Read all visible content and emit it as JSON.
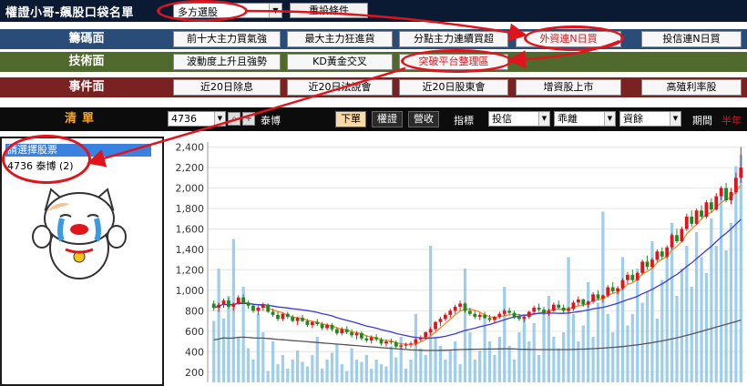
{
  "app": {
    "title": "權證小哥-飆股口袋名單"
  },
  "filter": {
    "selected": "多方選股",
    "reset_label": "重設條件"
  },
  "rows": {
    "chip": {
      "label": "籌碼面",
      "buttons": [
        "前十大主力買氣強",
        "最大主力狂進貨",
        "分點主力連續買超",
        "外資連N日買",
        "投信連N日買"
      ]
    },
    "tech": {
      "label": "技術面",
      "buttons": [
        "波動度上升且強勢",
        "KD黃金交叉",
        "突破平台整理區"
      ]
    },
    "event": {
      "label": "事件面",
      "buttons": [
        "近20日除息",
        "近20日法說會",
        "近20日股東會",
        "增資股上市",
        "高殖利率股"
      ]
    }
  },
  "list": {
    "title": "清單",
    "header": "請選擇股票",
    "items": [
      {
        "code": "4736",
        "name": "泰博",
        "count": "(2)"
      }
    ]
  },
  "toolbar": {
    "stock_code": "4736",
    "stock_name": "泰博",
    "buttons": [
      "下單",
      "權證",
      "營收"
    ],
    "indicator_label": "指標",
    "selects": [
      "投信",
      "乖離",
      "資餘"
    ],
    "period_label": "期間",
    "period_value": "半年"
  },
  "chart_data": {
    "type": "candlestick",
    "y_ticks": [
      200,
      400,
      600,
      800,
      1000,
      1200,
      1400,
      1600,
      1800,
      2000,
      2200,
      2400
    ],
    "y_tick_labels": [
      "200",
      "400",
      "600",
      "800",
      "1,000",
      "1,200",
      "1,400",
      "1,600",
      "1,800",
      "2,000",
      "2,200",
      "2,400"
    ],
    "ylim": [
      100,
      2450
    ],
    "grid": true,
    "ohlc": [
      [
        870,
        900,
        800,
        830
      ],
      [
        830,
        880,
        790,
        860
      ],
      [
        860,
        920,
        830,
        900
      ],
      [
        900,
        930,
        820,
        840
      ],
      [
        840,
        880,
        800,
        870
      ],
      [
        870,
        950,
        860,
        930
      ],
      [
        930,
        960,
        870,
        880
      ],
      [
        880,
        900,
        820,
        850
      ],
      [
        850,
        870,
        780,
        800
      ],
      [
        800,
        850,
        760,
        830
      ],
      [
        830,
        880,
        800,
        860
      ],
      [
        860,
        870,
        780,
        790
      ],
      [
        790,
        820,
        740,
        760
      ],
      [
        760,
        790,
        700,
        720
      ],
      [
        720,
        780,
        700,
        770
      ],
      [
        770,
        790,
        720,
        740
      ],
      [
        740,
        760,
        690,
        700
      ],
      [
        700,
        740,
        660,
        730
      ],
      [
        730,
        760,
        690,
        700
      ],
      [
        700,
        720,
        640,
        660
      ],
      [
        660,
        700,
        630,
        690
      ],
      [
        690,
        720,
        650,
        670
      ],
      [
        670,
        690,
        610,
        630
      ],
      [
        630,
        680,
        610,
        660
      ],
      [
        660,
        680,
        600,
        620
      ],
      [
        620,
        640,
        560,
        580
      ],
      [
        580,
        640,
        560,
        620
      ],
      [
        620,
        650,
        570,
        590
      ],
      [
        590,
        620,
        540,
        560
      ],
      [
        560,
        600,
        520,
        580
      ],
      [
        580,
        600,
        510,
        530
      ],
      [
        530,
        560,
        490,
        510
      ],
      [
        510,
        560,
        480,
        540
      ],
      [
        540,
        570,
        500,
        520
      ],
      [
        520,
        540,
        460,
        480
      ],
      [
        480,
        520,
        450,
        500
      ],
      [
        500,
        530,
        470,
        490
      ],
      [
        490,
        510,
        430,
        450
      ],
      [
        450,
        480,
        420,
        460
      ],
      [
        460,
        490,
        430,
        470
      ],
      [
        470,
        500,
        440,
        480
      ],
      [
        480,
        530,
        460,
        520
      ],
      [
        520,
        560,
        500,
        540
      ],
      [
        540,
        600,
        520,
        590
      ],
      [
        590,
        640,
        560,
        620
      ],
      [
        620,
        700,
        600,
        690
      ],
      [
        690,
        740,
        650,
        720
      ],
      [
        720,
        780,
        700,
        760
      ],
      [
        760,
        820,
        730,
        800
      ],
      [
        800,
        860,
        770,
        840
      ],
      [
        840,
        900,
        800,
        870
      ],
      [
        870,
        880,
        780,
        800
      ],
      [
        800,
        830,
        750,
        770
      ],
      [
        770,
        800,
        720,
        740
      ],
      [
        740,
        780,
        710,
        760
      ],
      [
        760,
        790,
        720,
        730
      ],
      [
        730,
        760,
        690,
        710
      ],
      [
        710,
        750,
        680,
        740
      ],
      [
        740,
        790,
        720,
        770
      ],
      [
        770,
        820,
        750,
        800
      ],
      [
        800,
        830,
        760,
        780
      ],
      [
        780,
        800,
        720,
        740
      ],
      [
        740,
        770,
        700,
        720
      ],
      [
        720,
        760,
        690,
        740
      ],
      [
        740,
        800,
        720,
        790
      ],
      [
        790,
        850,
        770,
        830
      ],
      [
        830,
        870,
        790,
        810
      ],
      [
        810,
        840,
        760,
        780
      ],
      [
        780,
        820,
        750,
        800
      ],
      [
        800,
        880,
        790,
        860
      ],
      [
        860,
        900,
        810,
        830
      ],
      [
        830,
        860,
        780,
        800
      ],
      [
        800,
        840,
        770,
        820
      ],
      [
        820,
        900,
        800,
        880
      ],
      [
        880,
        940,
        850,
        910
      ],
      [
        910,
        920,
        840,
        860
      ],
      [
        860,
        900,
        830,
        890
      ],
      [
        890,
        980,
        870,
        960
      ],
      [
        960,
        1000,
        900,
        920
      ],
      [
        920,
        960,
        880,
        950
      ],
      [
        950,
        1050,
        930,
        1030
      ],
      [
        1030,
        1080,
        970,
        990
      ],
      [
        990,
        1040,
        960,
        1020
      ],
      [
        1020,
        1120,
        1000,
        1100
      ],
      [
        1100,
        1180,
        1060,
        1150
      ],
      [
        1150,
        1200,
        1080,
        1100
      ],
      [
        1100,
        1180,
        1090,
        1170
      ],
      [
        1170,
        1300,
        1150,
        1280
      ],
      [
        1280,
        1340,
        1200,
        1230
      ],
      [
        1230,
        1320,
        1210,
        1300
      ],
      [
        1300,
        1400,
        1280,
        1380
      ],
      [
        1380,
        1420,
        1300,
        1330
      ],
      [
        1330,
        1440,
        1310,
        1420
      ],
      [
        1420,
        1560,
        1400,
        1540
      ],
      [
        1540,
        1600,
        1460,
        1480
      ],
      [
        1480,
        1620,
        1470,
        1600
      ],
      [
        1600,
        1750,
        1580,
        1720
      ],
      [
        1720,
        1780,
        1620,
        1650
      ],
      [
        1650,
        1800,
        1640,
        1780
      ],
      [
        1780,
        1830,
        1700,
        1720
      ],
      [
        1720,
        1880,
        1700,
        1860
      ],
      [
        1860,
        1900,
        1760,
        1790
      ],
      [
        1790,
        1950,
        1780,
        1920
      ],
      [
        1920,
        2020,
        1880,
        2000
      ],
      [
        2000,
        2050,
        1860,
        1880
      ],
      [
        1880,
        2000,
        1840,
        1960
      ],
      [
        1960,
        2150,
        1940,
        2100
      ],
      [
        2100,
        2400,
        2050,
        2200
      ]
    ],
    "volume": [
      0.27,
      0.5,
      0.28,
      0.38,
      0.63,
      0.2,
      0.42,
      0.15,
      0.1,
      0.3,
      0.22,
      0.05,
      0.18,
      0.08,
      0.12,
      0.06,
      0.1,
      0.14,
      0.09,
      0.07,
      0.12,
      0.2,
      0.06,
      0.1,
      0.13,
      0.17,
      0.08,
      0.05,
      0.15,
      0.1,
      0.09,
      0.12,
      0.06,
      0.1,
      0.08,
      0.07,
      0.16,
      0.11,
      0.2,
      0.06,
      0.1,
      0.3,
      0.15,
      0.12,
      0.6,
      0.2,
      0.16,
      0.1,
      0.14,
      0.18,
      0.08,
      0.5,
      0.22,
      0.1,
      0.14,
      0.3,
      0.18,
      0.12,
      0.2,
      0.42,
      0.16,
      0.1,
      0.22,
      0.3,
      0.18,
      0.26,
      0.12,
      0.32,
      0.38,
      0.2,
      0.15,
      0.22,
      0.55,
      0.3,
      0.18,
      0.25,
      0.44,
      0.2,
      0.35,
      0.75,
      0.3,
      0.22,
      0.4,
      0.55,
      0.25,
      0.3,
      0.5,
      0.35,
      0.4,
      0.62,
      0.28,
      0.45,
      0.55,
      0.7,
      0.38,
      0.5,
      0.6,
      0.42,
      0.66,
      0.55,
      0.48,
      0.72,
      0.6,
      0.82,
      0.58,
      0.7,
      0.95,
      1.0
    ]
  },
  "colors": {
    "up": "#e0141c",
    "down": "#1d8a1d",
    "ma_short": "#f08a24",
    "ma_mid": "#3a3ae0",
    "ma_long": "#555555",
    "volume": "#8ec5ea",
    "annotation": "#e0141c"
  },
  "icons": {
    "cat": "crying-cat-sticker",
    "search": "magnifier-icon",
    "add": "plus-icon"
  }
}
